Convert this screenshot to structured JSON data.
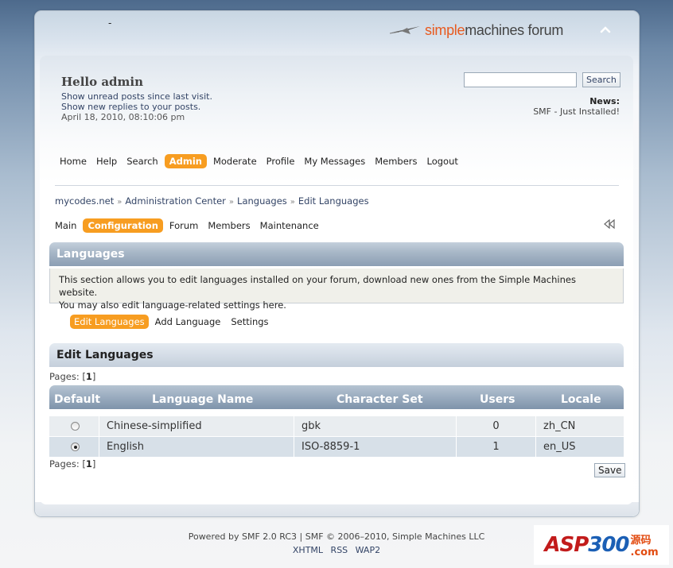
{
  "header": {
    "forum_title": "-",
    "logo_simple": "simple",
    "logo_machines": "machines forum"
  },
  "user": {
    "greeting": "Hello admin",
    "unread_posts": "Show unread posts since last visit.",
    "new_replies": "Show new replies to your posts.",
    "date": "April 18, 2010, 08:10:06 pm"
  },
  "search": {
    "value": "",
    "button": "Search"
  },
  "news": {
    "title": "News:",
    "text": "SMF - Just Installed!"
  },
  "menu": {
    "items": [
      "Home",
      "Help",
      "Search",
      "Admin",
      "Moderate",
      "Profile",
      "My Messages",
      "Members",
      "Logout"
    ],
    "active": "Admin"
  },
  "breadcrumb": [
    "mycodes.net",
    "Administration Center",
    "Languages",
    "Edit Languages"
  ],
  "admin_menu": {
    "items": [
      "Main",
      "Configuration",
      "Forum",
      "Members",
      "Maintenance"
    ],
    "active": "Configuration"
  },
  "section": {
    "title": "Languages",
    "desc_line1": "This section allows you to edit languages installed on your forum, download new ones from the Simple Machines website.",
    "desc_line2": "You may also edit language-related settings here."
  },
  "tabs": {
    "items": [
      "Edit Languages",
      "Add Language",
      "Settings"
    ],
    "active": "Edit Languages"
  },
  "edit": {
    "title": "Edit Languages",
    "pages_label": "Pages:",
    "pages_current": "1"
  },
  "table": {
    "columns": [
      "Default",
      "Language Name",
      "Character Set",
      "Users",
      "Locale"
    ],
    "rows": [
      {
        "default": false,
        "name": "Chinese-simplified",
        "charset": "gbk",
        "users": "0",
        "locale": "zh_CN"
      },
      {
        "default": true,
        "name": "English",
        "charset": "ISO-8859-1",
        "users": "1",
        "locale": "en_US"
      }
    ]
  },
  "save_button": "Save",
  "footer": {
    "line1": "Powered by SMF 2.0 RC3 | SMF © 2006–2010, Simple Machines LLC",
    "links": [
      "XHTML",
      "RSS",
      "WAP2"
    ]
  },
  "watermark": {
    "text_a": "ASP",
    "text_b": "300",
    "text_c": "源码",
    "text_d": ".com"
  },
  "colors": {
    "accent": "#f79d21",
    "link": "#334466",
    "header_bar": "#8b9eb3"
  }
}
